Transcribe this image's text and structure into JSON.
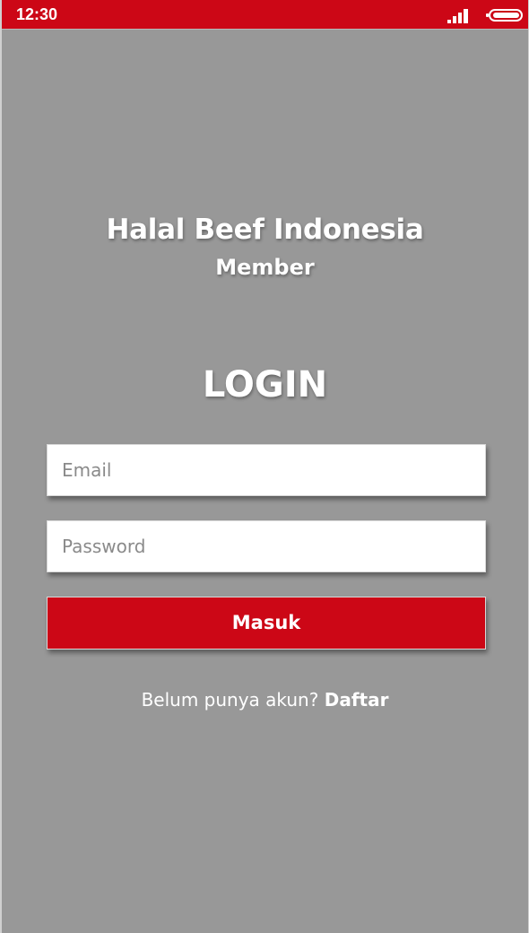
{
  "status_bar": {
    "time": "12:30",
    "signal_icon": "signal-bars-icon",
    "battery_icon": "battery-icon",
    "color": "#cc0716"
  },
  "header": {
    "app_name": "Halal Beef Indonesia",
    "subtitle": "Member"
  },
  "login": {
    "title": "LOGIN",
    "email_placeholder": "Email",
    "password_placeholder": "Password",
    "submit_label": "Masuk",
    "register_prompt": "Belum punya akun?",
    "register_link": "Daftar"
  },
  "colors": {
    "brand_red": "#cc0716",
    "background": "#989898"
  }
}
